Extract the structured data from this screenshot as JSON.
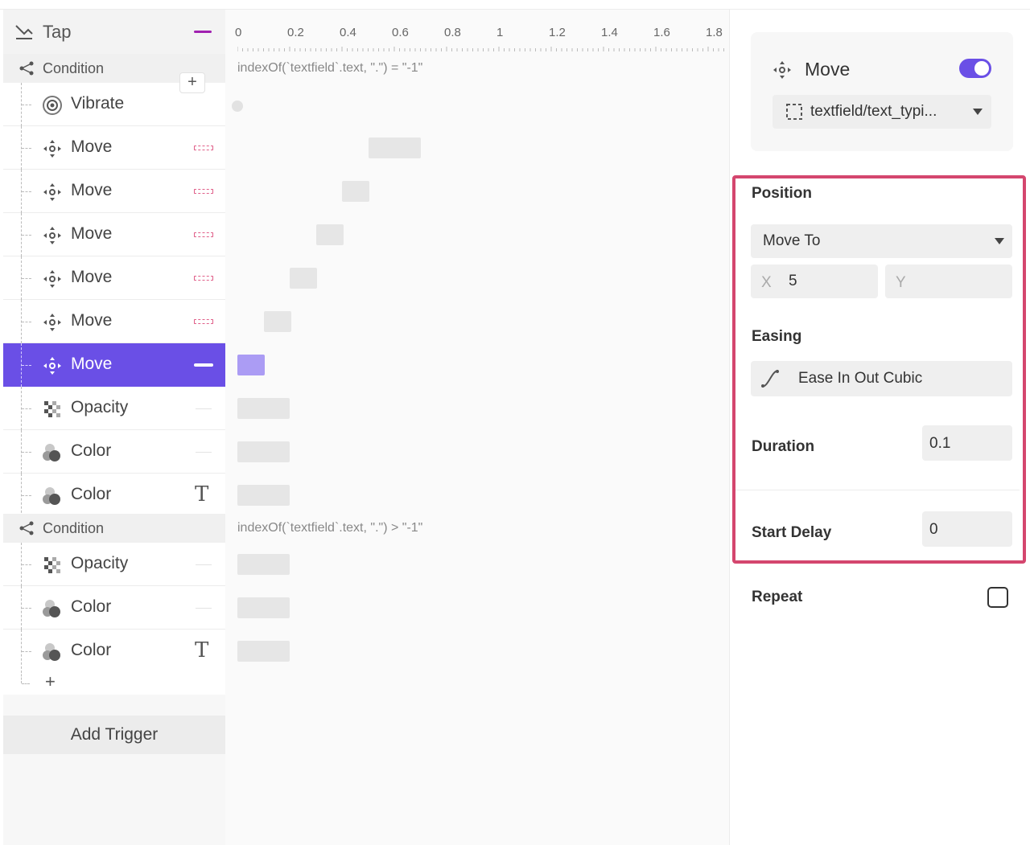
{
  "trigger": {
    "label": "Tap"
  },
  "conditions": [
    {
      "label": "Condition",
      "expression": "indexOf(`textfield`.text, \".\") = \"-1\"",
      "actions": [
        {
          "label": "Vibrate",
          "icon": "vibrate-icon"
        },
        {
          "label": "Move",
          "icon": "move-icon"
        },
        {
          "label": "Move",
          "icon": "move-icon"
        },
        {
          "label": "Move",
          "icon": "move-icon"
        },
        {
          "label": "Move",
          "icon": "move-icon"
        },
        {
          "label": "Move",
          "icon": "move-icon"
        },
        {
          "label": "Move",
          "icon": "move-icon",
          "selected": true
        },
        {
          "label": "Opacity",
          "icon": "opacity-icon"
        },
        {
          "label": "Color",
          "icon": "color-icon"
        },
        {
          "label": "Color",
          "icon": "color-icon",
          "badge": "T"
        }
      ]
    },
    {
      "label": "Condition",
      "expression": "indexOf(`textfield`.text, \".\") > \"-1\"",
      "actions": [
        {
          "label": "Opacity",
          "icon": "opacity-icon"
        },
        {
          "label": "Color",
          "icon": "color-icon"
        },
        {
          "label": "Color",
          "icon": "color-icon",
          "badge": "T"
        }
      ]
    }
  ],
  "add_action": "+",
  "add_condition": "+",
  "add_trigger": "Add Trigger",
  "ruler": [
    "0",
    "0.2",
    "0.4",
    "0.6",
    "0.8",
    "1",
    "1.2",
    "1.4",
    "1.6",
    "1.8"
  ],
  "timeline_bars": [
    {
      "start": 0.5,
      "duration": 0.2
    },
    {
      "start": 0.4,
      "duration": 0.1
    },
    {
      "start": 0.3,
      "duration": 0.1
    },
    {
      "start": 0.2,
      "duration": 0.1
    },
    {
      "start": 0.1,
      "duration": 0.1
    },
    {
      "start": 0.0,
      "duration": 0.1,
      "selected": true
    },
    {
      "start": 0.0,
      "duration": 0.2
    },
    {
      "start": 0.0,
      "duration": 0.2
    },
    {
      "start": 0.0,
      "duration": 0.2
    },
    {
      "start": 0.0,
      "duration": 0.2
    },
    {
      "start": 0.0,
      "duration": 0.2
    },
    {
      "start": 0.0,
      "duration": 0.2
    }
  ],
  "inspector": {
    "action_title": "Move",
    "enabled": true,
    "target": "textfield/text_typi...",
    "position": {
      "label": "Position",
      "mode": "Move To",
      "x_label": "X",
      "x_value": "5",
      "y_label": "Y",
      "y_value": ""
    },
    "easing": {
      "label": "Easing",
      "value": "Ease In Out Cubic"
    },
    "duration": {
      "label": "Duration",
      "value": "0.1"
    },
    "start_delay": {
      "label": "Start Delay",
      "value": "0"
    },
    "repeat": {
      "label": "Repeat",
      "checked": false
    }
  },
  "colors": {
    "accent": "#6a4fe6",
    "highlight": "#d4466e",
    "trigger_mark": "#a020b0"
  }
}
